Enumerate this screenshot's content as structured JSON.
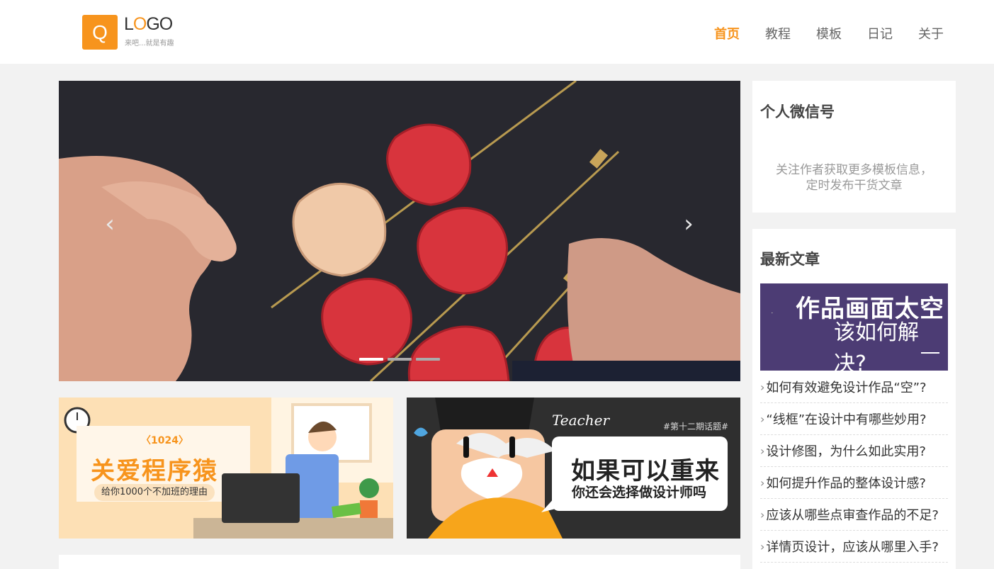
{
  "header": {
    "logo_letter": "Q",
    "logo_word_1": "L",
    "logo_word_2": "O",
    "logo_word_3": "GO",
    "logo_tagline": "来吧...就是有趣",
    "nav": [
      "首页",
      "教程",
      "模板",
      "日记",
      "关于"
    ],
    "active_nav": "首页"
  },
  "slider": {
    "prev_icon": "‹",
    "next_icon": "›",
    "active_dot": 0,
    "dot_count": 3
  },
  "banners": {
    "left": {
      "badge": "〈1024〉",
      "title": "关爱程序猿",
      "subtitle": "给你1000个不加班的理由"
    },
    "right": {
      "word": "Teacher",
      "tag": "#第十二期话题#",
      "title": "如果可以重来",
      "subtitle": "你还会选择做设计师吗"
    }
  },
  "sidebar": {
    "wechat": {
      "title": "个人微信号",
      "desc": "关注作者获取更多模板信息，定时发布干货文章"
    },
    "latest": {
      "title": "最新文章",
      "thumb_line1": "作品画面太空",
      "thumb_line2": "该如何解决?",
      "articles": [
        "如何有效避免设计作品“空”?",
        "“线框”在设计中有哪些妙用?",
        "设计修图，为什么如此实用?",
        "如何提升作品的整体设计感?",
        "应该从哪些点审查作品的不足?",
        "详情页设计，应该从哪里入手?"
      ]
    }
  },
  "colors": {
    "accent": "#f7941d",
    "page_bg": "#f2f2f2",
    "thumb_bg": "#4c3c74"
  }
}
